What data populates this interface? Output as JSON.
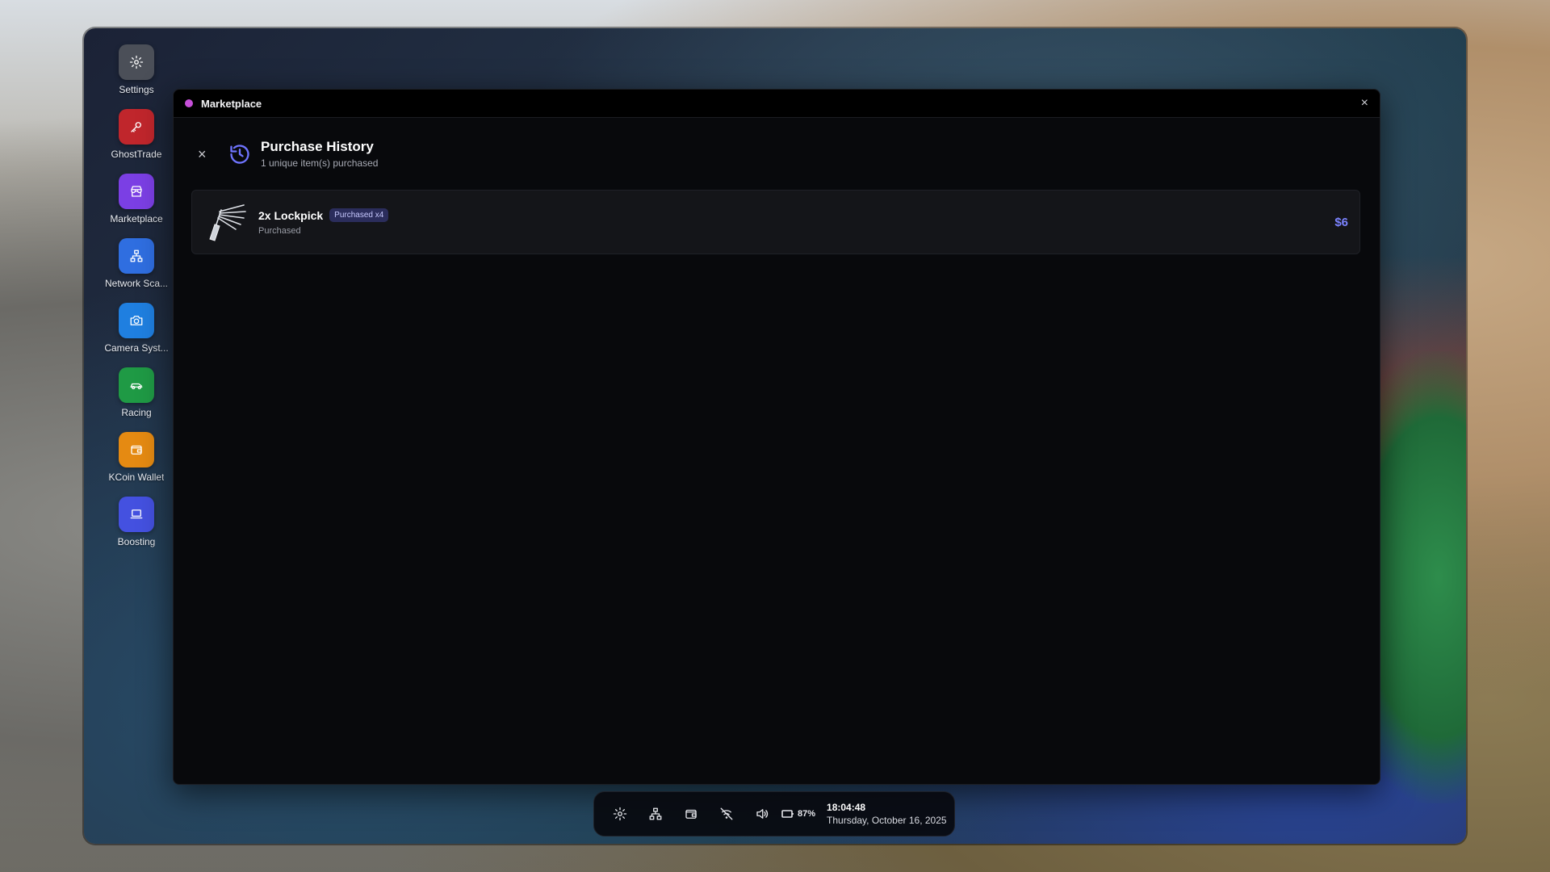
{
  "sidebar": {
    "items": [
      {
        "label": "Settings",
        "icon": "gear-icon",
        "color": "#4b4f58"
      },
      {
        "label": "GhostTrade",
        "icon": "key-icon",
        "color": "#c0262c"
      },
      {
        "label": "Marketplace",
        "icon": "store-icon",
        "color": "#7b3fe4"
      },
      {
        "label": "Network Sca...",
        "icon": "network-icon",
        "color": "#2f6ee0"
      },
      {
        "label": "Camera Syst...",
        "icon": "camera-icon",
        "color": "#1f7fe0"
      },
      {
        "label": "Racing",
        "icon": "car-icon",
        "color": "#1f9a45"
      },
      {
        "label": "KCoin Wallet",
        "icon": "wallet-icon",
        "color": "#e58a12"
      },
      {
        "label": "Boosting",
        "icon": "laptop-icon",
        "color": "#4451e0"
      }
    ]
  },
  "window": {
    "title": "Marketplace",
    "dot_color": "#c64fd9",
    "close_label": "×"
  },
  "history": {
    "close_label": "×",
    "title": "Purchase History",
    "subtitle": "1 unique item(s) purchased",
    "items": [
      {
        "name": "2x Lockpick",
        "badge": "Purchased x4",
        "status": "Purchased",
        "price": "$6"
      }
    ]
  },
  "taskbar": {
    "icons": [
      "gear-icon",
      "network-icon",
      "wallet-icon",
      "wifi-off-icon",
      "volume-icon"
    ],
    "battery": "87%",
    "time": "18:04:48",
    "date": "Thursday, October 16, 2025"
  },
  "colors": {
    "accent": "#6f74ff",
    "price": "#7b83ff",
    "badge_bg": "#2b2d5c"
  }
}
